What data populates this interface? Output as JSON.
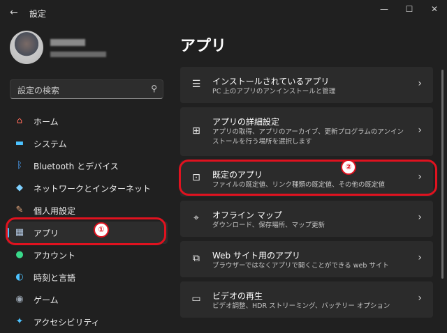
{
  "window": {
    "title": "設定",
    "back_symbol": "←",
    "controls": {
      "minimize": "—",
      "maximize": "☐",
      "close": "✕"
    }
  },
  "search": {
    "placeholder": "設定の検索",
    "icon": "search-icon"
  },
  "sidebar": {
    "items": [
      {
        "label": "ホーム",
        "icon": "home-icon",
        "glyph": "⌂",
        "color": "#ff6b5a"
      },
      {
        "label": "システム",
        "icon": "monitor-icon",
        "glyph": "▬",
        "color": "#4cc2ff"
      },
      {
        "label": "Bluetooth とデバイス",
        "icon": "bluetooth-icon",
        "glyph": "ᛒ",
        "color": "#4ca6ff"
      },
      {
        "label": "ネットワークとインターネット",
        "icon": "wifi-icon",
        "glyph": "◆",
        "color": "#7fd1ff"
      },
      {
        "label": "個人用設定",
        "icon": "brush-icon",
        "glyph": "✎",
        "color": "#e8a87c"
      },
      {
        "label": "アプリ",
        "icon": "apps-icon",
        "glyph": "▦",
        "color": "#b0c4de",
        "active": true
      },
      {
        "label": "アカウント",
        "icon": "account-icon",
        "glyph": "●",
        "color": "#39d98a"
      },
      {
        "label": "時刻と言語",
        "icon": "globe-clock-icon",
        "glyph": "◐",
        "color": "#4cc2ff"
      },
      {
        "label": "ゲーム",
        "icon": "gamepad-icon",
        "glyph": "◉",
        "color": "#9aa5b1"
      },
      {
        "label": "アクセシビリティ",
        "icon": "accessibility-icon",
        "glyph": "✦",
        "color": "#4cc2ff"
      }
    ]
  },
  "main": {
    "title": "アプリ",
    "cards": [
      {
        "title": "インストールされているアプリ",
        "desc": "PC 上のアプリのアンインストールと管理",
        "icon": "list-icon",
        "glyph": "☰"
      },
      {
        "title": "アプリの詳細設定",
        "desc": "アプリの取得、アプリのアーカイブ、更新プログラムのアンインストールを行う場所を選択します",
        "icon": "app-settings-icon",
        "glyph": "⊞"
      },
      {
        "title": "既定のアプリ",
        "desc": "ファイルの既定値、リンク種類の既定値、その他の既定値",
        "icon": "default-apps-icon",
        "glyph": "⊡"
      },
      {
        "title": "オフライン マップ",
        "desc": "ダウンロード、保存場所、マップ更新",
        "icon": "map-icon",
        "glyph": "⌖"
      },
      {
        "title": "Web サイト用のアプリ",
        "desc": "ブラウザーではなくアプリで開くことができる web サイト",
        "icon": "web-apps-icon",
        "glyph": "⧉"
      },
      {
        "title": "ビデオの再生",
        "desc": "ビデオ調整、HDR ストリーミング、バッテリー オプション",
        "icon": "video-icon",
        "glyph": "▭"
      }
    ],
    "chevron": "›"
  },
  "annotations": {
    "one": "①",
    "two": "②",
    "color": "#e0121f"
  }
}
